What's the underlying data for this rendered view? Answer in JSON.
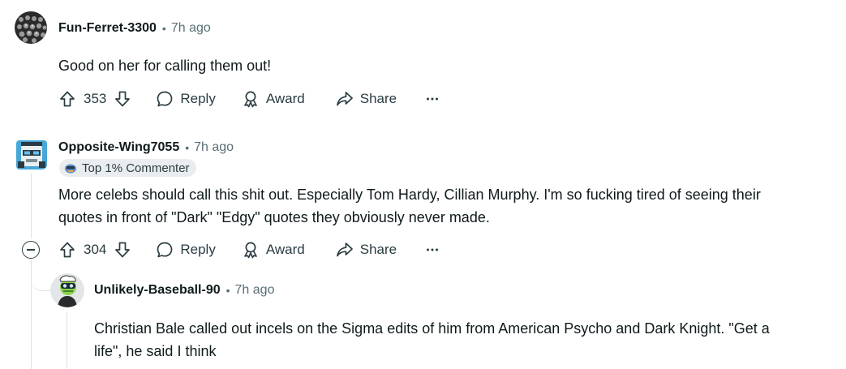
{
  "comments": [
    {
      "username": "Fun-Ferret-3300",
      "time": "7h ago",
      "body": [
        "Good on her for calling them out!"
      ],
      "score": "353",
      "actions": {
        "reply": "Reply",
        "award": "Award",
        "share": "Share"
      }
    },
    {
      "username": "Opposite-Wing7055",
      "time": "7h ago",
      "flair": "Top 1% Commenter",
      "body": [
        "More celebs should call this shit out. Especially Tom Hardy, Cillian Murphy. I'm so fucking tired of seeing their",
        "quotes in front of \"Dark\" \"Edgy\" quotes they obviously never made."
      ],
      "score": "304",
      "actions": {
        "reply": "Reply",
        "award": "Award",
        "share": "Share"
      }
    },
    {
      "username": "Unlikely-Baseball-90",
      "time": "7h ago",
      "body": [
        "Christian Bale called out incels on the Sigma edits of him from American Psycho and Dark Knight. \"Get a",
        "life\", he said I think"
      ]
    }
  ],
  "separator": "•",
  "colors": {
    "text": "#0f1a1c",
    "muted": "#576f76",
    "icon": "#2a3c42",
    "flair_bg": "#eaedef",
    "thread_line": "#dfe3e5"
  },
  "icons": [
    "upvote-icon",
    "downvote-icon",
    "reply-icon",
    "award-icon",
    "share-icon",
    "more-icon",
    "collapse-icon"
  ]
}
